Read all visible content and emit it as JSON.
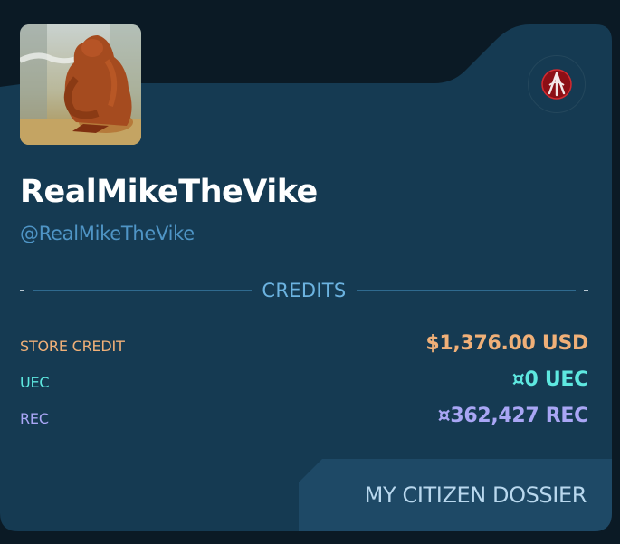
{
  "profile": {
    "display_name": "RealMikeTheVike",
    "handle": "@RealMikeTheVike",
    "avatar": "bigfoot-avatar",
    "org_badge": "organization-emblem-icon"
  },
  "credits": {
    "title": "CREDITS",
    "rows": [
      {
        "label": "STORE CREDIT",
        "value": "$1,376.00 USD",
        "color": "#f0b078"
      },
      {
        "label": "UEC",
        "value": "¤0 UEC",
        "color": "#5ee8e0"
      },
      {
        "label": "REC",
        "value": "¤362,427 REC",
        "color": "#a9a6f5"
      }
    ]
  },
  "actions": {
    "dossier_label": "MY CITIZEN DOSSIER"
  },
  "colors": {
    "background": "#0b1a25",
    "card": "#153a52",
    "button": "#1e4966",
    "accent": "#6cb3e0"
  }
}
